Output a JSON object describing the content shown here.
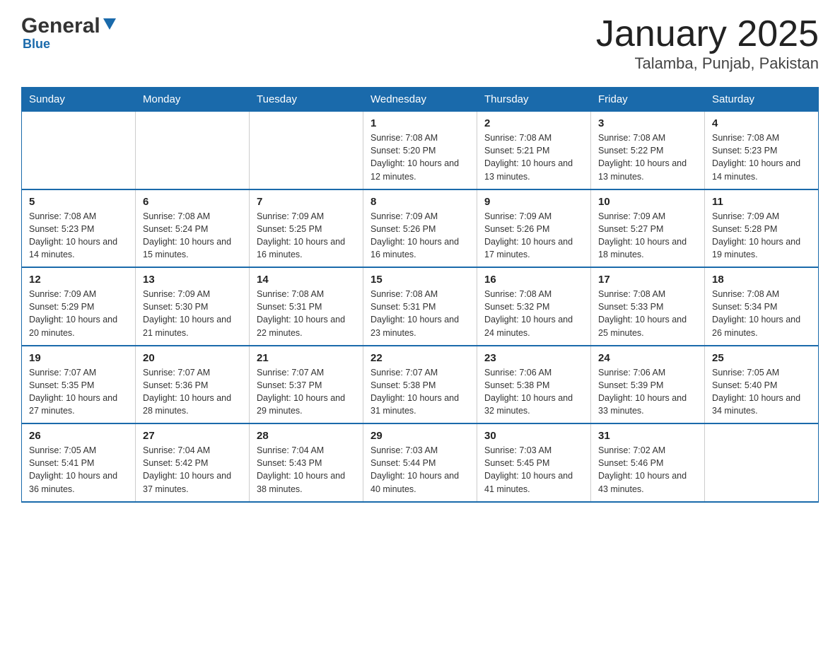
{
  "header": {
    "logo_general": "General",
    "logo_blue": "Blue",
    "title": "January 2025",
    "subtitle": "Talamba, Punjab, Pakistan"
  },
  "days_of_week": [
    "Sunday",
    "Monday",
    "Tuesday",
    "Wednesday",
    "Thursday",
    "Friday",
    "Saturday"
  ],
  "weeks": [
    [
      {
        "day": "",
        "info": ""
      },
      {
        "day": "",
        "info": ""
      },
      {
        "day": "",
        "info": ""
      },
      {
        "day": "1",
        "info": "Sunrise: 7:08 AM\nSunset: 5:20 PM\nDaylight: 10 hours\nand 12 minutes."
      },
      {
        "day": "2",
        "info": "Sunrise: 7:08 AM\nSunset: 5:21 PM\nDaylight: 10 hours\nand 13 minutes."
      },
      {
        "day": "3",
        "info": "Sunrise: 7:08 AM\nSunset: 5:22 PM\nDaylight: 10 hours\nand 13 minutes."
      },
      {
        "day": "4",
        "info": "Sunrise: 7:08 AM\nSunset: 5:23 PM\nDaylight: 10 hours\nand 14 minutes."
      }
    ],
    [
      {
        "day": "5",
        "info": "Sunrise: 7:08 AM\nSunset: 5:23 PM\nDaylight: 10 hours\nand 14 minutes."
      },
      {
        "day": "6",
        "info": "Sunrise: 7:08 AM\nSunset: 5:24 PM\nDaylight: 10 hours\nand 15 minutes."
      },
      {
        "day": "7",
        "info": "Sunrise: 7:09 AM\nSunset: 5:25 PM\nDaylight: 10 hours\nand 16 minutes."
      },
      {
        "day": "8",
        "info": "Sunrise: 7:09 AM\nSunset: 5:26 PM\nDaylight: 10 hours\nand 16 minutes."
      },
      {
        "day": "9",
        "info": "Sunrise: 7:09 AM\nSunset: 5:26 PM\nDaylight: 10 hours\nand 17 minutes."
      },
      {
        "day": "10",
        "info": "Sunrise: 7:09 AM\nSunset: 5:27 PM\nDaylight: 10 hours\nand 18 minutes."
      },
      {
        "day": "11",
        "info": "Sunrise: 7:09 AM\nSunset: 5:28 PM\nDaylight: 10 hours\nand 19 minutes."
      }
    ],
    [
      {
        "day": "12",
        "info": "Sunrise: 7:09 AM\nSunset: 5:29 PM\nDaylight: 10 hours\nand 20 minutes."
      },
      {
        "day": "13",
        "info": "Sunrise: 7:09 AM\nSunset: 5:30 PM\nDaylight: 10 hours\nand 21 minutes."
      },
      {
        "day": "14",
        "info": "Sunrise: 7:08 AM\nSunset: 5:31 PM\nDaylight: 10 hours\nand 22 minutes."
      },
      {
        "day": "15",
        "info": "Sunrise: 7:08 AM\nSunset: 5:31 PM\nDaylight: 10 hours\nand 23 minutes."
      },
      {
        "day": "16",
        "info": "Sunrise: 7:08 AM\nSunset: 5:32 PM\nDaylight: 10 hours\nand 24 minutes."
      },
      {
        "day": "17",
        "info": "Sunrise: 7:08 AM\nSunset: 5:33 PM\nDaylight: 10 hours\nand 25 minutes."
      },
      {
        "day": "18",
        "info": "Sunrise: 7:08 AM\nSunset: 5:34 PM\nDaylight: 10 hours\nand 26 minutes."
      }
    ],
    [
      {
        "day": "19",
        "info": "Sunrise: 7:07 AM\nSunset: 5:35 PM\nDaylight: 10 hours\nand 27 minutes."
      },
      {
        "day": "20",
        "info": "Sunrise: 7:07 AM\nSunset: 5:36 PM\nDaylight: 10 hours\nand 28 minutes."
      },
      {
        "day": "21",
        "info": "Sunrise: 7:07 AM\nSunset: 5:37 PM\nDaylight: 10 hours\nand 29 minutes."
      },
      {
        "day": "22",
        "info": "Sunrise: 7:07 AM\nSunset: 5:38 PM\nDaylight: 10 hours\nand 31 minutes."
      },
      {
        "day": "23",
        "info": "Sunrise: 7:06 AM\nSunset: 5:38 PM\nDaylight: 10 hours\nand 32 minutes."
      },
      {
        "day": "24",
        "info": "Sunrise: 7:06 AM\nSunset: 5:39 PM\nDaylight: 10 hours\nand 33 minutes."
      },
      {
        "day": "25",
        "info": "Sunrise: 7:05 AM\nSunset: 5:40 PM\nDaylight: 10 hours\nand 34 minutes."
      }
    ],
    [
      {
        "day": "26",
        "info": "Sunrise: 7:05 AM\nSunset: 5:41 PM\nDaylight: 10 hours\nand 36 minutes."
      },
      {
        "day": "27",
        "info": "Sunrise: 7:04 AM\nSunset: 5:42 PM\nDaylight: 10 hours\nand 37 minutes."
      },
      {
        "day": "28",
        "info": "Sunrise: 7:04 AM\nSunset: 5:43 PM\nDaylight: 10 hours\nand 38 minutes."
      },
      {
        "day": "29",
        "info": "Sunrise: 7:03 AM\nSunset: 5:44 PM\nDaylight: 10 hours\nand 40 minutes."
      },
      {
        "day": "30",
        "info": "Sunrise: 7:03 AM\nSunset: 5:45 PM\nDaylight: 10 hours\nand 41 minutes."
      },
      {
        "day": "31",
        "info": "Sunrise: 7:02 AM\nSunset: 5:46 PM\nDaylight: 10 hours\nand 43 minutes."
      },
      {
        "day": "",
        "info": ""
      }
    ]
  ]
}
